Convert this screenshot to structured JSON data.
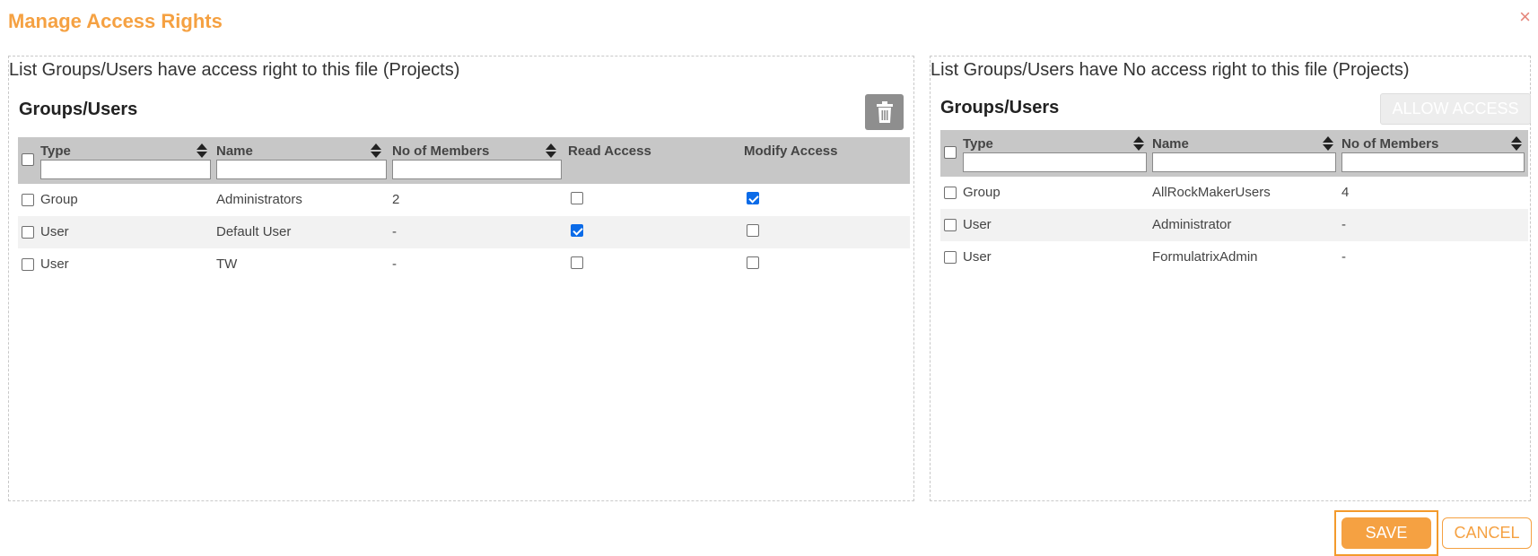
{
  "dialog": {
    "title": "Manage Access Rights",
    "close_icon": "×"
  },
  "left": {
    "caption": "List Groups/Users have access right to this file (Projects)",
    "heading": "Groups/Users",
    "delete_icon": "trash-icon",
    "columns": {
      "type": "Type",
      "name": "Name",
      "members": "No of Members",
      "read": "Read Access",
      "modify": "Modify Access"
    },
    "rows": [
      {
        "type": "Group",
        "name": "Administrators",
        "members": "2",
        "read": false,
        "modify": true
      },
      {
        "type": "User",
        "name": "Default User",
        "members": "-",
        "read": true,
        "modify": false
      },
      {
        "type": "User",
        "name": "TW",
        "members": "-",
        "read": false,
        "modify": false
      }
    ]
  },
  "right": {
    "caption": "List Groups/Users have No access right to this file (Projects)",
    "heading": "Groups/Users",
    "allow_label": "ALLOW ACCESS",
    "columns": {
      "type": "Type",
      "name": "Name",
      "members": "No of Members"
    },
    "rows": [
      {
        "type": "Group",
        "name": "AllRockMakerUsers",
        "members": "4"
      },
      {
        "type": "User",
        "name": "Administrator",
        "members": "-"
      },
      {
        "type": "User",
        "name": "FormulatrixAdmin",
        "members": "-"
      }
    ]
  },
  "footer": {
    "save_label": "SAVE",
    "cancel_label": "CANCEL"
  },
  "colors": {
    "accent": "#f5a142",
    "checked": "#0b6be8",
    "header_bg": "#c7c7c7"
  }
}
